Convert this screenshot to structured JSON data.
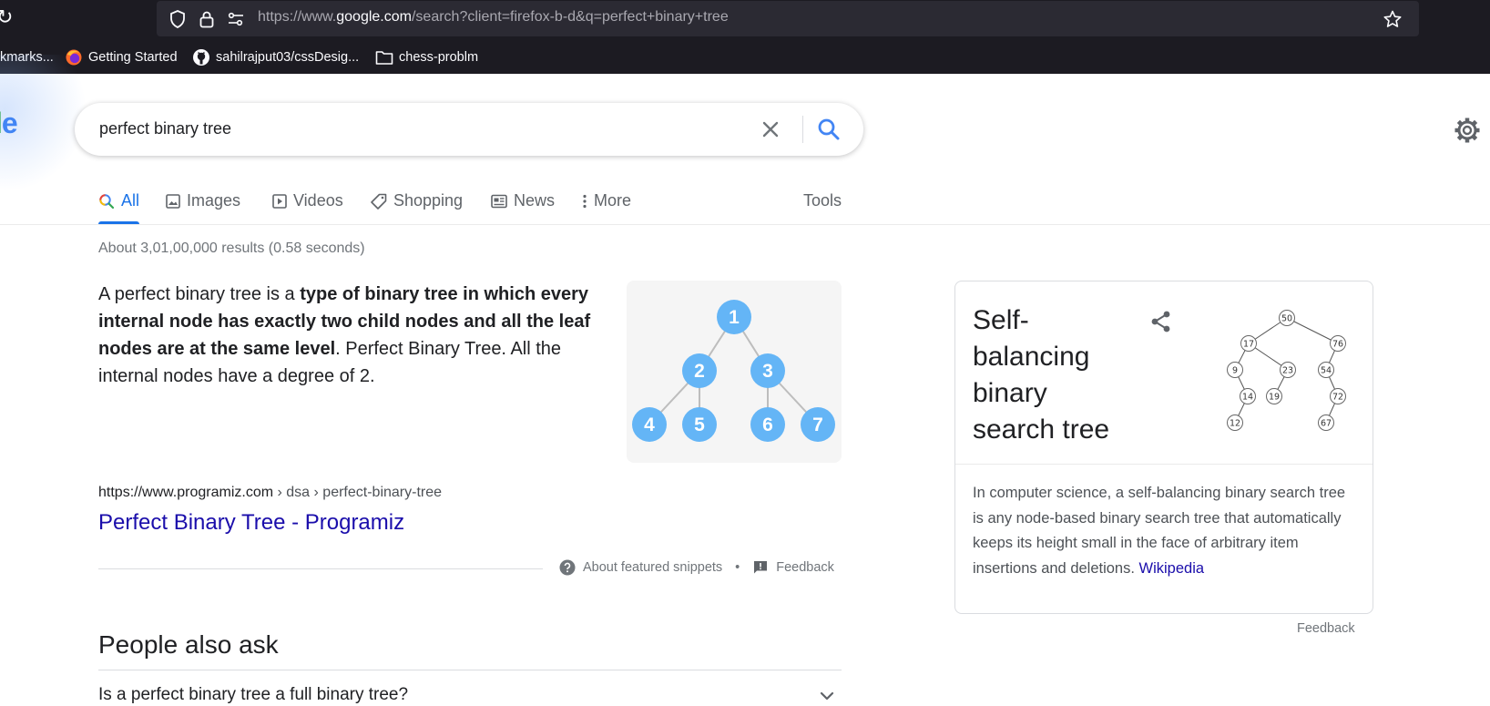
{
  "browser": {
    "url_prefix": "https://www.",
    "url_host": "google.com",
    "url_rest": "/search?client=firefox-b-d&q=perfect+binary+tree",
    "bookmarks": [
      {
        "label": "kmarks...",
        "icon": "none"
      },
      {
        "label": "Getting Started",
        "icon": "firefox-icon"
      },
      {
        "label": "sahilrajput03/cssDesig...",
        "icon": "github-icon"
      },
      {
        "label": "chess-problm",
        "icon": "folder-icon"
      }
    ]
  },
  "google": {
    "logo_fragment_green": "l",
    "logo_fragment_blue": "e"
  },
  "search": {
    "query": "perfect binary tree"
  },
  "tabs": {
    "all": "All",
    "images": "Images",
    "videos": "Videos",
    "shopping": "Shopping",
    "news": "News",
    "more": "More",
    "tools": "Tools"
  },
  "stats": "About 3,01,00,000 results (0.58 seconds)",
  "snippet": {
    "text_start": "A perfect binary tree is a ",
    "text_bold": "type of binary tree in which every internal node has exactly two child nodes and all the leaf nodes are at the same level",
    "text_end": ". Perfect Binary Tree. All the internal nodes have a degree of 2.",
    "image_nodes": [
      "1",
      "2",
      "3",
      "4",
      "5",
      "6",
      "7"
    ],
    "cite_domain": "https://www.programiz.com",
    "cite_path": " › dsa › perfect-binary-tree",
    "title": "Perfect Binary Tree - Programiz",
    "about": "About featured snippets",
    "separator": "•",
    "feedback": "Feedback"
  },
  "paa": {
    "title": "People also ask",
    "questions": [
      "Is a perfect binary tree a full binary tree?"
    ]
  },
  "knowledge_panel": {
    "title": "Self-balancing binary search tree",
    "image_nodes": [
      "50",
      "17",
      "76",
      "9",
      "23",
      "54",
      "14",
      "19",
      "72",
      "12",
      "67"
    ],
    "description": "In computer science, a self-balancing binary search tree is any node-based binary search tree that automatically keeps its height small in the face of arbitrary item insertions and deletions. ",
    "source": "Wikipedia",
    "feedback": "Feedback"
  },
  "colors": {
    "accent": "#1a73e8",
    "link": "#1a0dab",
    "tree_node": "#64b5f6",
    "chrome_bg": "#1c1b22"
  }
}
